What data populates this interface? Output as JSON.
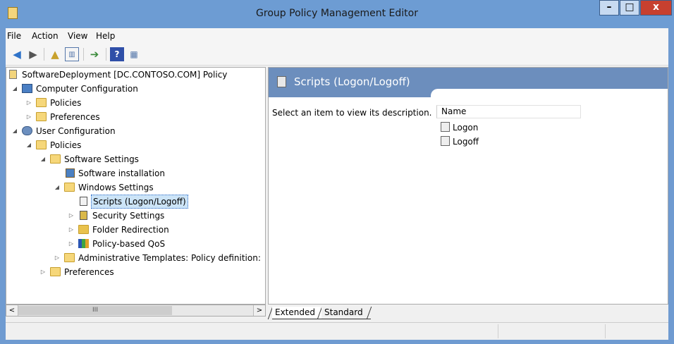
{
  "window": {
    "title": "Group Policy Management Editor",
    "buttons": {
      "minimize": "–",
      "maximize": "□",
      "close": "x"
    }
  },
  "menu": [
    "File",
    "Action",
    "View",
    "Help"
  ],
  "tree": {
    "root": "SoftwareDeployment [DC.CONTOSO.COM] Policy",
    "computer_configuration": "Computer Configuration",
    "cc_policies": "Policies",
    "cc_preferences": "Preferences",
    "user_configuration": "User Configuration",
    "uc_policies": "Policies",
    "software_settings": "Software Settings",
    "software_installation": "Software installation",
    "windows_settings": "Windows Settings",
    "scripts": "Scripts (Logon/Logoff)",
    "security_settings": "Security Settings",
    "folder_redirection": "Folder Redirection",
    "policy_based_qos": "Policy-based QoS",
    "administrative_templates": "Administrative Templates: Policy definition:",
    "uc_preferences": "Preferences"
  },
  "scrollbar": {
    "left": "<",
    "right": ">",
    "thumb": "III"
  },
  "details": {
    "title": "Scripts (Logon/Logoff)",
    "description": "Select an item to view its description.",
    "column_name": "Name",
    "items": [
      "Logon",
      "Logoff"
    ]
  },
  "tabs": {
    "extended": "Extended",
    "standard": "Standard"
  }
}
